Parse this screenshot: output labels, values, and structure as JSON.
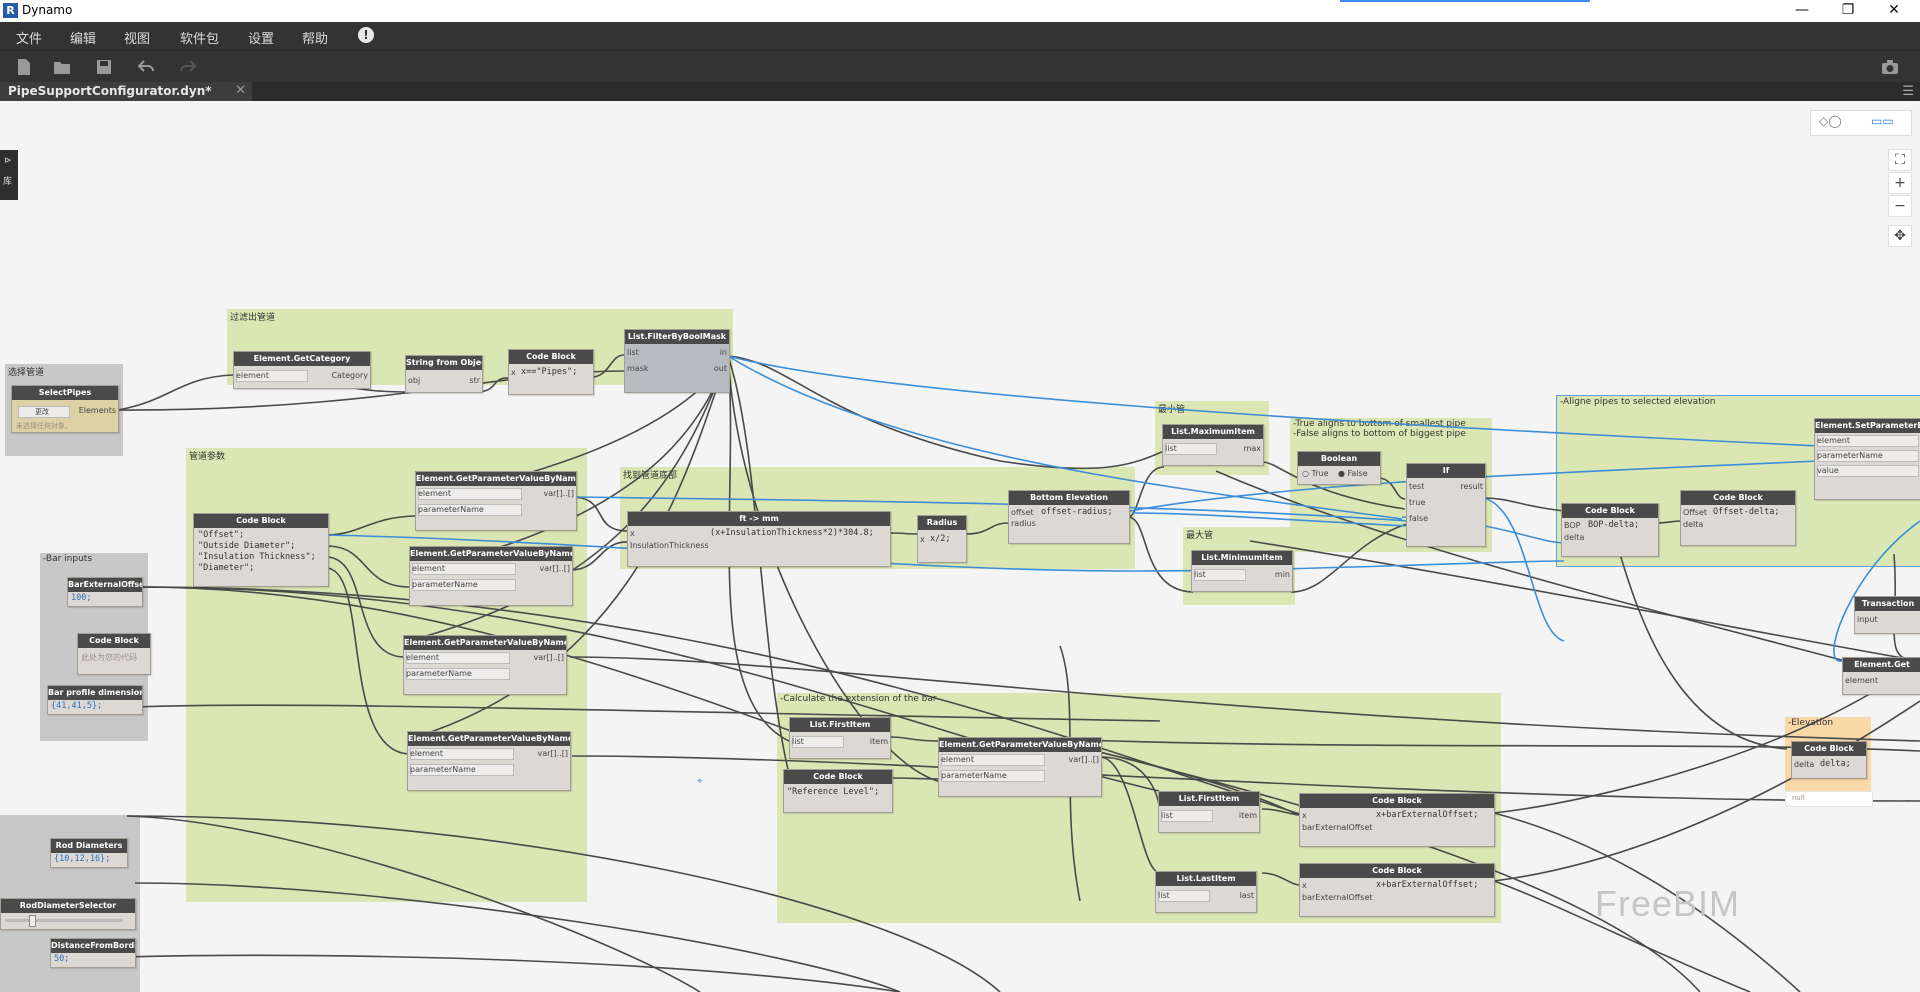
{
  "window": {
    "title": "Dynamo",
    "minimize": "—",
    "restore": "❐",
    "close": "✕"
  },
  "menu": {
    "items": [
      "文件",
      "编辑",
      "视图",
      "软件包",
      "设置",
      "帮助"
    ],
    "alert": "!"
  },
  "tab": {
    "label": "PipeSupportConfigurator.dyn*",
    "close": "✕"
  },
  "side_panel": {
    "label": "库"
  },
  "canvas_controls": {
    "fit": "⛶",
    "zoom_in": "+",
    "zoom_out": "−",
    "pan": "✥"
  },
  "watermark": "FreeBIM",
  "groups": {
    "select_pipes": "选择管道",
    "filter_pipes": "过滤出管道",
    "pipe_params": "管道参数",
    "bar_inputs": "-Bar inputs",
    "bottom_elev": "找到管道底部",
    "smallest": "最小管",
    "largest": "最大管",
    "true_false": "-True aligns to bottom of smallest pipe\n-False aligns to bottom of biggest pipe",
    "align": "-Aligne pipes to selected elevation",
    "calc_ext": "-Calculate the extension of the bar",
    "elevation": "-Elevation"
  },
  "nodes": {
    "select_pipes": {
      "title": "SelectPipes",
      "btn": "更改",
      "out": "Elements",
      "preview": "未选择任何对象。"
    },
    "get_category": {
      "title": "Element.GetCategory",
      "in": "element",
      "out": "Category"
    },
    "string_from_obj": {
      "title": "String from Object",
      "in": "obj",
      "out": "str"
    },
    "cb_pipes": {
      "title": "Code Block",
      "in": "x",
      "code": "x==\"Pipes\";"
    },
    "filter_mask": {
      "title": "List.FilterByBoolMask",
      "in1": "list",
      "in2": "mask",
      "out1": "in",
      "out2": "out"
    },
    "cb_params": {
      "title": "Code Block",
      "code": "\"Offset\";\n\"Outside Diameter\";\n\"Insulation Thickness\";\n\"Diameter\";"
    },
    "gp1": {
      "title": "Element.GetParameterValueByName",
      "in1": "element",
      "in2": "parameterName",
      "out": "var[]..[]"
    },
    "gp2": {
      "title": "Element.GetParameterValueByName",
      "in1": "element",
      "in2": "parameterName",
      "out": "var[]..[]"
    },
    "gp3": {
      "title": "Element.GetParameterValueByName",
      "in1": "element",
      "in2": "parameterName",
      "out": "var[]..[]"
    },
    "gp4": {
      "title": "Element.GetParameterValueByName",
      "in1": "element",
      "in2": "parameterName",
      "out": "var[]..[]"
    },
    "ft_mm": {
      "title": "ft -> mm",
      "in1": "x",
      "in2": "InsulationThickness",
      "code": "(x+InsulationThickness*2)*304.8;"
    },
    "radius": {
      "title": "Radius",
      "in": "x",
      "code": "x/2;"
    },
    "bottom_elev": {
      "title": "Bottom Elevation",
      "in1": "offset",
      "in2": "radius",
      "code": "offset-radius;"
    },
    "list_max": {
      "title": "List.MaximumItem",
      "in": "list",
      "out": "max"
    },
    "list_min": {
      "title": "List.MinimumItem",
      "in": "list",
      "out": "min"
    },
    "boolean": {
      "title": "Boolean",
      "opt_true": "True",
      "opt_false": "False"
    },
    "if_node": {
      "title": "If",
      "in1": "test",
      "in2": "true",
      "in3": "false",
      "out": "result"
    },
    "cb_bop": {
      "title": "Code Block",
      "in1": "BOP",
      "in2": "delta",
      "code": "BOP-delta;"
    },
    "cb_offset": {
      "title": "Code Block",
      "in1": "Offset",
      "in2": "delta",
      "code": "Offset-delta;"
    },
    "set_param": {
      "title": "Element.SetParameterByName",
      "in1": "element",
      "in2": "parameterName",
      "in3": "value"
    },
    "transaction": {
      "title": "Transaction",
      "in": "input"
    },
    "element_get": {
      "title": "Element.Get",
      "in": "element"
    },
    "bar_ext_offset": {
      "title": "BarExternalOffset",
      "code": "100;"
    },
    "cb_empty": {
      "title": "Code Block",
      "placeholder": "此处为您的代码"
    },
    "bar_profile": {
      "title": "Bar profile dimensions",
      "code": "{41,41,5};"
    },
    "first_item1": {
      "title": "List.FirstItem",
      "in": "list",
      "out": "item"
    },
    "cb_ref_level": {
      "title": "Code Block",
      "code": "\"Reference Level\";"
    },
    "gp5": {
      "title": "Element.GetParameterValueByName",
      "in1": "element",
      "in2": "parameterName",
      "out": "var[]..[]"
    },
    "first_item2": {
      "title": "List.FirstItem",
      "in": "list",
      "out": "item"
    },
    "last_item": {
      "title": "List.LastItem",
      "in": "list",
      "out": "last"
    },
    "cb_ext1": {
      "title": "Code Block",
      "in1": "x",
      "in2": "barExternalOffset",
      "code": "x+barExternalOffset;"
    },
    "cb_ext2": {
      "title": "Code Block",
      "in1": "x",
      "in2": "barExternalOffset",
      "code": "x+barExternalOffset;"
    },
    "cb_delta": {
      "title": "Code Block",
      "in": "delta",
      "code": "delta;",
      "preview": "null"
    },
    "rod_diam": {
      "title": "Rod Diameters",
      "code": "{10,12,16};"
    },
    "rod_selector": {
      "title": "RodDiameterSelector"
    },
    "dist_border": {
      "title": "DistanceFromBorder",
      "code": "50;"
    }
  }
}
